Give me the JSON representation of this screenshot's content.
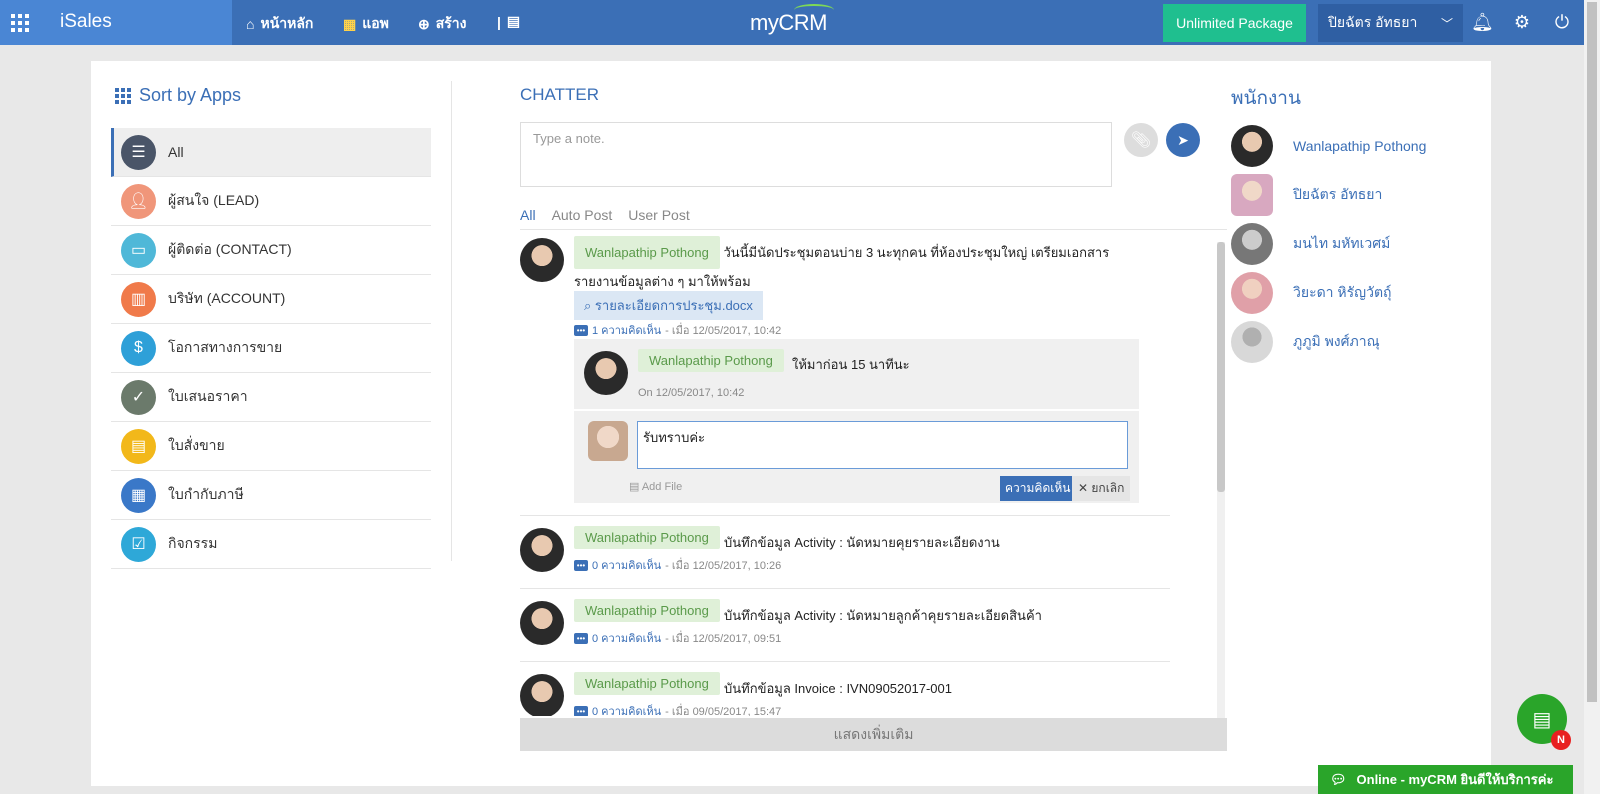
{
  "topbar": {
    "brand": "iSales",
    "nav": [
      {
        "label": "หน้าหลัก",
        "icon": "home-icon"
      },
      {
        "label": "แอพ",
        "icon": "apps-grid-icon"
      },
      {
        "label": "สร้าง",
        "icon": "plus-circle-icon"
      }
    ],
    "logo": "myCRM",
    "package": "Unlimited Package",
    "user": "ปิยฉัตร อัทธยา"
  },
  "sidebar": {
    "title": "Sort by Apps",
    "items": [
      {
        "label": "All",
        "color": "#4a5568"
      },
      {
        "label": "ผู้สนใจ (LEAD)",
        "color": "#f0967a"
      },
      {
        "label": "ผู้ติดต่อ (CONTACT)",
        "color": "#4fb8d8"
      },
      {
        "label": "บริษัท (ACCOUNT)",
        "color": "#f07a4a"
      },
      {
        "label": "โอกาสทางการขาย",
        "color": "#2ea0d8"
      },
      {
        "label": "ใบเสนอราคา",
        "color": "#6b7a6b"
      },
      {
        "label": "ใบสั่งขาย",
        "color": "#f2b81a"
      },
      {
        "label": "ใบกำกับภาษี",
        "color": "#3a78c8"
      },
      {
        "label": "กิจกรรม",
        "color": "#2ea8d8"
      }
    ]
  },
  "chatter": {
    "title": "CHATTER",
    "note_placeholder": "Type a note.",
    "filters": [
      "All",
      "Auto Post",
      "User Post"
    ],
    "posts": [
      {
        "author": "Wanlapathip Pothong",
        "text": "วันนี้มีนัดประชุมตอนบ่าย 3 นะทุกคน ที่ห้องประชุมใหญ่ เตรียมเอกสารรายงานข้อมูลต่าง ๆ มาให้พร้อม",
        "attachment": "รายละเอียดการประชุม.docx",
        "comments": "1 ความคิดเห็น",
        "date": "- เมื่อ 12/05/2017, 10:42"
      },
      {
        "author": "Wanlapathip Pothong",
        "text": "บันทึกข้อมูล Activity : นัดหมายคุยรายละเอียดงาน",
        "comments": "0 ความคิดเห็น",
        "date": "- เมื่อ 12/05/2017, 10:26"
      },
      {
        "author": "Wanlapathip Pothong",
        "text": "บันทึกข้อมูล Activity : นัดหมายลูกค้าคุยรายละเอียดสินค้า",
        "comments": "0 ความคิดเห็น",
        "date": "- เมื่อ 12/05/2017, 09:51"
      },
      {
        "author": "Wanlapathip Pothong",
        "text": "บันทึกข้อมูล Invoice : IVN09052017-001",
        "comments": "0 ความคิดเห็น",
        "date": "- เมื่อ 09/05/2017, 15:47"
      }
    ],
    "reply": {
      "author": "Wanlapathip Pothong",
      "text": "ให้มาก่อน 15 นาทีนะ",
      "date": "On 12/05/2017, 10:42",
      "input_value": "รับทราบค่ะ",
      "add_file": "Add File",
      "comment_btn": "ความคิดเห็น",
      "cancel_btn": "ยกเลิก"
    },
    "show_more": "แสดงเพิ่มเติม"
  },
  "employees": {
    "title": "พนักงาน",
    "list": [
      "Wanlapathip Pothong",
      "ปิยฉัตร อัทธยา",
      "มนไท มหัทเวศม์",
      "วิยะดา หิรัญวัตถุ์",
      "ภูภูมิ พงศ์ภาณุ"
    ]
  },
  "chat_widget": {
    "badge": "N",
    "online_text": "Online - myCRM ยินดีให้บริการค่ะ"
  }
}
